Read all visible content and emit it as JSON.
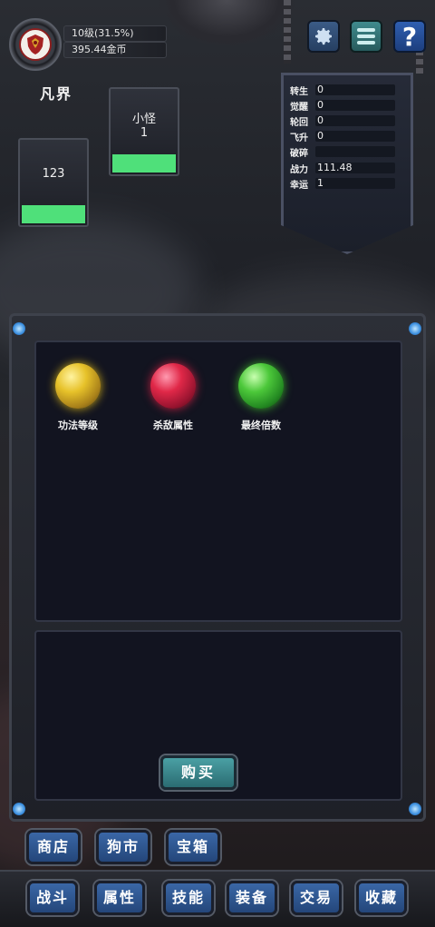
{
  "player": {
    "level_text": "10级(31.5%)",
    "gold_text": "395.44金币",
    "realm": "凡界"
  },
  "monsters": [
    {
      "name": "123",
      "hp": 1.0
    },
    {
      "name": "小怪",
      "count": "1",
      "hp": 1.0
    }
  ],
  "stats": [
    {
      "key": "转生",
      "value": "0"
    },
    {
      "key": "觉醒",
      "value": "0"
    },
    {
      "key": "轮回",
      "value": "0"
    },
    {
      "key": "飞升",
      "value": "0"
    },
    {
      "key": "破碎",
      "value": ""
    },
    {
      "key": "战力",
      "value": "111.48"
    },
    {
      "key": "幸运",
      "value": "1"
    }
  ],
  "orbs": [
    {
      "label": "功法等级",
      "icon": "yellow-orb-icon"
    },
    {
      "label": "杀敌属性",
      "icon": "red-orb-icon"
    },
    {
      "label": "最终倍数",
      "icon": "green-orb-icon"
    }
  ],
  "buy_label": "购买",
  "top_buttons": {
    "settings_icon": "gear-icon",
    "menu_icon": "list-icon",
    "help_label": "?"
  },
  "secondary_nav": [
    "商店",
    "狗市",
    "宝箱"
  ],
  "main_nav": [
    "战斗",
    "属性",
    "技能",
    "装备",
    "交易",
    "收藏"
  ],
  "colors": {
    "hp_bar": "#4fe07a",
    "nav_button": "#2f5a96",
    "buy_button": "#3a8a90"
  }
}
